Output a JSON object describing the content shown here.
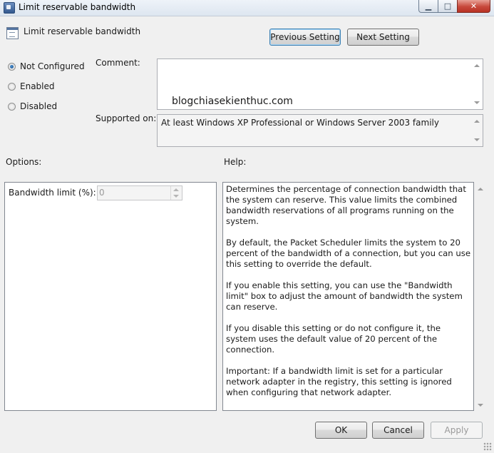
{
  "window": {
    "title": "Limit reservable bandwidth",
    "minimize_glyph": "▁",
    "maximize_glyph": "□",
    "close_glyph": "✕"
  },
  "header": {
    "policy_title": "Limit reservable bandwidth",
    "prev_button": "Previous Setting",
    "next_button": "Next Setting"
  },
  "state": {
    "options": [
      {
        "label": "Not Configured",
        "checked": true
      },
      {
        "label": "Enabled",
        "checked": false
      },
      {
        "label": "Disabled",
        "checked": false
      }
    ]
  },
  "comment": {
    "label": "Comment:",
    "value": "blogchiasekienthuc.com"
  },
  "supported": {
    "label": "Supported on:",
    "value": "At least Windows XP Professional or Windows Server 2003 family"
  },
  "options_section": {
    "label": "Options:",
    "bandwidth_label": "Bandwidth limit (%):",
    "bandwidth_value": "0"
  },
  "help": {
    "label": "Help:",
    "paragraphs": [
      "Determines the percentage of connection bandwidth that the system can reserve. This value limits the combined bandwidth reservations of all programs running on the system.",
      "By default, the Packet Scheduler limits the system to 20 percent of the bandwidth of a connection, but you can use this setting to override the default.",
      "If you enable this setting, you can use the \"Bandwidth limit\" box to adjust the amount of bandwidth the system can reserve.",
      "If you disable this setting or do not configure it, the system uses the default value of 20 percent of the connection.",
      "Important: If a bandwidth limit is set for a particular network adapter in the registry, this setting is ignored when configuring that network adapter."
    ]
  },
  "footer": {
    "ok": "OK",
    "cancel": "Cancel",
    "apply": "Apply"
  }
}
